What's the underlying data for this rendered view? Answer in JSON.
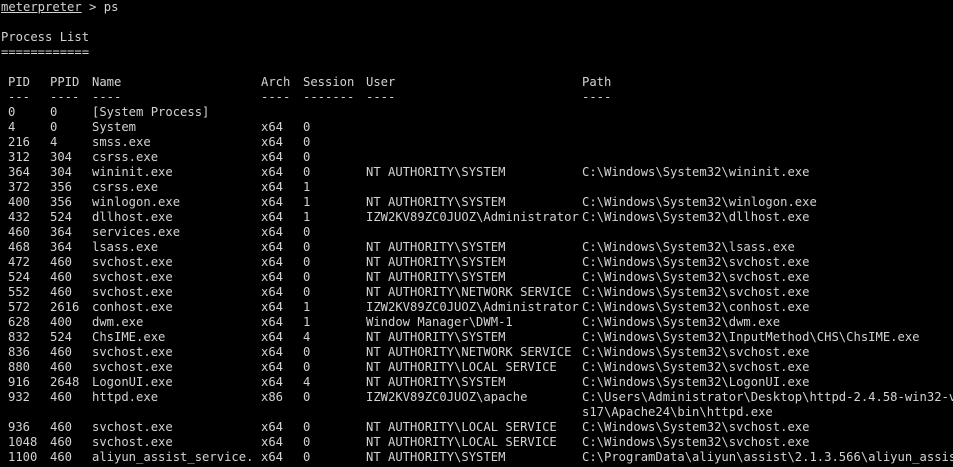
{
  "terminal": {
    "prompt": "meterpreter",
    "prompt_sep": " > ",
    "command": "ps",
    "heading": "Process List",
    "heading_rule": "============",
    "columns": {
      "pid": "PID",
      "ppid": "PPID",
      "name": "Name",
      "arch": "Arch",
      "session": "Session",
      "user": "User",
      "path": "Path"
    },
    "dividers": {
      "pid": "---",
      "ppid": "----",
      "name": "----",
      "arch": "----",
      "session": "-------",
      "user": "----",
      "path": "----"
    },
    "rows": [
      {
        "pid": "0",
        "ppid": "0",
        "name": "[System Process]",
        "arch": "",
        "session": "",
        "user": "",
        "path": ""
      },
      {
        "pid": "4",
        "ppid": "0",
        "name": "System",
        "arch": "x64",
        "session": "0",
        "user": "",
        "path": ""
      },
      {
        "pid": "216",
        "ppid": "4",
        "name": "smss.exe",
        "arch": "x64",
        "session": "0",
        "user": "",
        "path": ""
      },
      {
        "pid": "312",
        "ppid": "304",
        "name": "csrss.exe",
        "arch": "x64",
        "session": "0",
        "user": "",
        "path": ""
      },
      {
        "pid": "364",
        "ppid": "304",
        "name": "wininit.exe",
        "arch": "x64",
        "session": "0",
        "user": "NT AUTHORITY\\SYSTEM",
        "path": "C:\\Windows\\System32\\wininit.exe"
      },
      {
        "pid": "372",
        "ppid": "356",
        "name": "csrss.exe",
        "arch": "x64",
        "session": "1",
        "user": "",
        "path": ""
      },
      {
        "pid": "400",
        "ppid": "356",
        "name": "winlogon.exe",
        "arch": "x64",
        "session": "1",
        "user": "NT AUTHORITY\\SYSTEM",
        "path": "C:\\Windows\\System32\\winlogon.exe"
      },
      {
        "pid": "432",
        "ppid": "524",
        "name": "dllhost.exe",
        "arch": "x64",
        "session": "1",
        "user": "IZW2KV89ZC0JUOZ\\Administrator",
        "path": "C:\\Windows\\System32\\dllhost.exe"
      },
      {
        "pid": "460",
        "ppid": "364",
        "name": "services.exe",
        "arch": "x64",
        "session": "0",
        "user": "",
        "path": ""
      },
      {
        "pid": "468",
        "ppid": "364",
        "name": "lsass.exe",
        "arch": "x64",
        "session": "0",
        "user": "NT AUTHORITY\\SYSTEM",
        "path": "C:\\Windows\\System32\\lsass.exe"
      },
      {
        "pid": "472",
        "ppid": "460",
        "name": "svchost.exe",
        "arch": "x64",
        "session": "0",
        "user": "NT AUTHORITY\\SYSTEM",
        "path": "C:\\Windows\\System32\\svchost.exe"
      },
      {
        "pid": "524",
        "ppid": "460",
        "name": "svchost.exe",
        "arch": "x64",
        "session": "0",
        "user": "NT AUTHORITY\\SYSTEM",
        "path": "C:\\Windows\\System32\\svchost.exe"
      },
      {
        "pid": "552",
        "ppid": "460",
        "name": "svchost.exe",
        "arch": "x64",
        "session": "0",
        "user": "NT AUTHORITY\\NETWORK SERVICE",
        "path": "C:\\Windows\\System32\\svchost.exe"
      },
      {
        "pid": "572",
        "ppid": "2616",
        "name": "conhost.exe",
        "arch": "x64",
        "session": "1",
        "user": "IZW2KV89ZC0JUOZ\\Administrator",
        "path": "C:\\Windows\\System32\\conhost.exe"
      },
      {
        "pid": "628",
        "ppid": "400",
        "name": "dwm.exe",
        "arch": "x64",
        "session": "1",
        "user": "Window Manager\\DWM-1",
        "path": "C:\\Windows\\System32\\dwm.exe"
      },
      {
        "pid": "832",
        "ppid": "524",
        "name": "ChsIME.exe",
        "arch": "x64",
        "session": "4",
        "user": "NT AUTHORITY\\SYSTEM",
        "path": "C:\\Windows\\System32\\InputMethod\\CHS\\ChsIME.exe"
      },
      {
        "pid": "836",
        "ppid": "460",
        "name": "svchost.exe",
        "arch": "x64",
        "session": "0",
        "user": "NT AUTHORITY\\NETWORK SERVICE",
        "path": "C:\\Windows\\System32\\svchost.exe"
      },
      {
        "pid": "880",
        "ppid": "460",
        "name": "svchost.exe",
        "arch": "x64",
        "session": "0",
        "user": "NT AUTHORITY\\LOCAL SERVICE",
        "path": "C:\\Windows\\System32\\svchost.exe"
      },
      {
        "pid": "916",
        "ppid": "2648",
        "name": "LogonUI.exe",
        "arch": "x64",
        "session": "4",
        "user": "NT AUTHORITY\\SYSTEM",
        "path": "C:\\Windows\\System32\\LogonUI.exe"
      },
      {
        "pid": "932",
        "ppid": "460",
        "name": "httpd.exe",
        "arch": "x86",
        "session": "0",
        "user": "IZW2KV89ZC0JUOZ\\apache",
        "path": "C:\\Users\\Administrator\\Desktop\\httpd-2.4.58-win32-v",
        "path_cont": "s17\\Apache24\\bin\\httpd.exe"
      },
      {
        "pid": "936",
        "ppid": "460",
        "name": "svchost.exe",
        "arch": "x64",
        "session": "0",
        "user": "NT AUTHORITY\\LOCAL SERVICE",
        "path": "C:\\Windows\\System32\\svchost.exe"
      },
      {
        "pid": "1048",
        "ppid": "460",
        "name": "svchost.exe",
        "arch": "x64",
        "session": "0",
        "user": "NT AUTHORITY\\LOCAL SERVICE",
        "path": "C:\\Windows\\System32\\svchost.exe"
      },
      {
        "pid": "1100",
        "ppid": "460",
        "name": "aliyun_assist_service.",
        "arch": "x64",
        "session": "0",
        "user": "NT AUTHORITY\\SYSTEM",
        "path": "C:\\ProgramData\\aliyun\\assist\\2.1.3.566\\aliyun_assis"
      }
    ]
  }
}
